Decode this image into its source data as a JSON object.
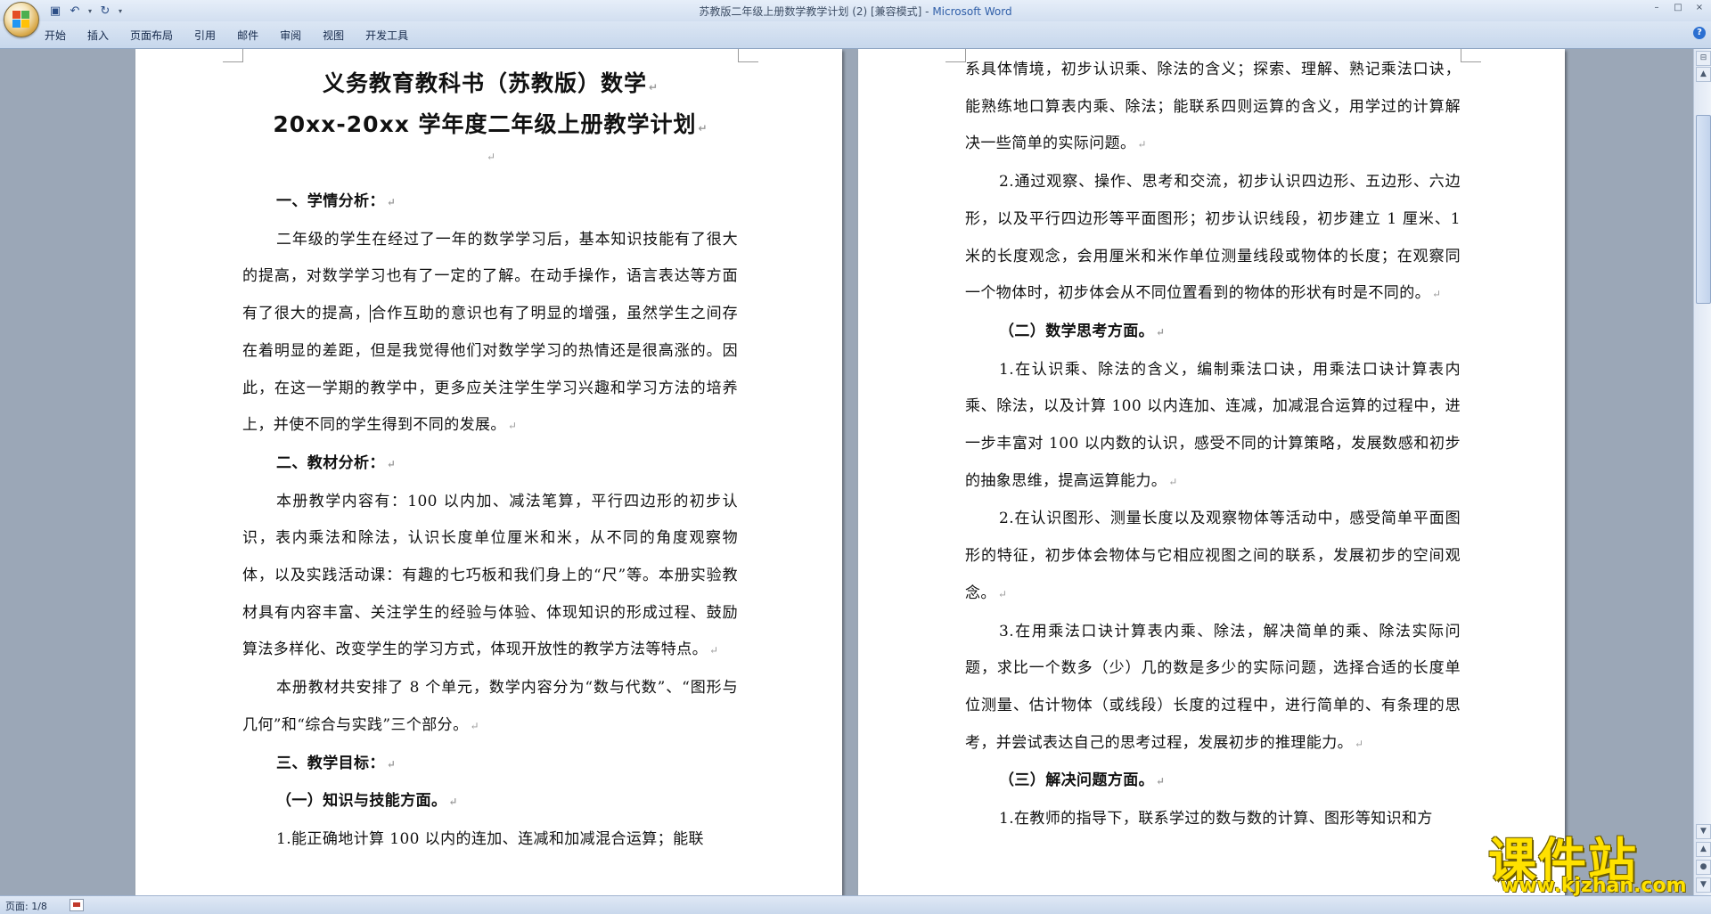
{
  "window": {
    "title_doc": "苏教版二年级上册数学教学计划 (2) [兼容模式] - ",
    "title_app": "Microsoft Word",
    "minimize": "–",
    "maximize": "□",
    "close": "×"
  },
  "qat": {
    "save": "▣",
    "undo": "↶",
    "undo_menu": "▾",
    "redo": "↻",
    "customize": "▾"
  },
  "ribbon": {
    "tabs": [
      "开始",
      "插入",
      "页面布局",
      "引用",
      "邮件",
      "审阅",
      "视图",
      "开发工具"
    ],
    "help": "?"
  },
  "page1": {
    "title1": "义务教育教科书（苏教版）数学",
    "title2": "20xx-20xx 学年度二年级上册教学计划",
    "h1": "一、学情分析：",
    "p1a": "二年级的学生在经过了一年的数学学习后，基本知识技能有了很大的提高，对数学学习也有了一定的了解。在动手操作，语言表达等方面有了很大的提高，",
    "p1b": "合作互助的意识也有了明显的增强，虽然学生之间存在着明显的差距，但是我觉得他们对数学学习的热情还是很高涨的。因此，在这一学期的教学中，更多应关注学生学习兴趣和学习方法的培养上，并使不同的学生得到不同的发展。",
    "h2": "二、教材分析：",
    "p2": "本册教学内容有：100 以内加、减法笔算，平行四边形的初步认识，表内乘法和除法，认识长度单位厘米和米，从不同的角度观察物体，以及实践活动课：有趣的七巧板和我们身上的“尺”等。本册实验教材具有内容丰富、关注学生的经验与体验、体现知识的形成过程、鼓励算法多样化、改变学生的学习方式，体现开放性的教学方法等特点。",
    "p3": "本册教材共安排了 8 个单元，数学内容分为“数与代数”、“图形与几何”和“综合与实践”三个部分。",
    "h3": "三、教学目标：",
    "h3a": "（一）知识与技能方面。",
    "p4": "1.能正确地计算 100 以内的连加、连减和加减混合运算；能联"
  },
  "page2": {
    "p1": "系具体情境，初步认识乘、除法的含义；探索、理解、熟记乘法口诀，能熟练地口算表内乘、除法；能联系四则运算的含义，用学过的计算解决一些简单的实际问题。",
    "p2": "2.通过观察、操作、思考和交流，初步认识四边形、五边形、六边形，以及平行四边形等平面图形；初步认识线段，初步建立 1 厘米、1 米的长度观念，会用厘米和米作单位测量线段或物体的长度；在观察同一个物体时，初步体会从不同位置看到的物体的形状有时是不同的。",
    "h1": "（二）数学思考方面。",
    "p3": "1.在认识乘、除法的含义，编制乘法口诀，用乘法口诀计算表内乘、除法，以及计算 100 以内连加、连减，加减混合运算的过程中，进一步丰富对 100 以内数的认识，感受不同的计算策略，发展数感和初步的抽象思维，提高运算能力。",
    "p4": "2.在认识图形、测量长度以及观察物体等活动中，感受简单平面图形的特征，初步体会物体与它相应视图之间的联系，发展初步的空间观念。",
    "p5": "3.在用乘法口诀计算表内乘、除法，解决简单的乘、除法实际问题，求比一个数多（少）几的数是多少的实际问题，选择合适的长度单位测量、估计物体（或线段）长度的过程中，进行简单的、有条理的思考，并尝试表达自己的思考过程，发展初步的推理能力。",
    "h2": "（三）解决问题方面。",
    "p6": "1.在教师的指导下，联系学过的数与数的计算、图形等知识和方"
  },
  "paragraph_mark": "↵",
  "statusbar": {
    "page": "页面: 1/8"
  },
  "scrollbar": {
    "up": "▲",
    "down": "▼",
    "prev": "▲",
    "browse": "●",
    "next": "▼"
  },
  "watermark": {
    "title": "课件站",
    "url": "www.kjzhan.com"
  },
  "colors": {
    "app_accent": "#2f5ea8",
    "watermark": "#ffe100"
  }
}
